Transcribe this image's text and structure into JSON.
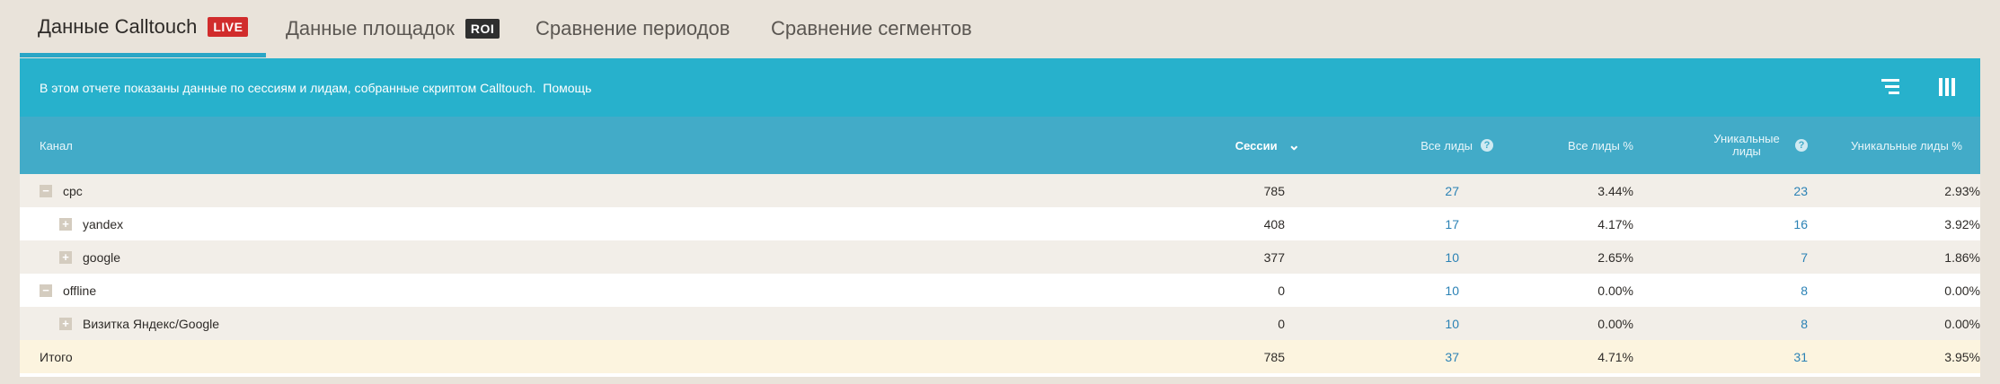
{
  "tabs": [
    {
      "label": "Данные Calltouch",
      "badge": "LIVE"
    },
    {
      "label": "Данные площадок",
      "badge": "ROI"
    },
    {
      "label": "Сравнение периодов"
    },
    {
      "label": "Сравнение сегментов"
    }
  ],
  "info": {
    "text": "В этом отчете показаны данные по сессиям и лидам, собранные скриптом Calltouch.",
    "help": "Помощь"
  },
  "icons": {
    "filter": "filter-lines-icon",
    "columns": "columns-icon"
  },
  "columns": {
    "channel": "Канал",
    "sessions": "Сессии",
    "all_leads": "Все лиды",
    "all_leads_pct": "Все лиды %",
    "unique_leads": "Уникальные лиды",
    "unique_leads_pct": "Уникальные лиды %"
  },
  "rows": [
    {
      "toggle": "−",
      "channel": "cpc",
      "sessions": "785",
      "all_leads": "27",
      "all_leads_pct": "3.44%",
      "unique_leads": "23",
      "unique_leads_pct": "2.93%"
    },
    {
      "toggle": "+",
      "channel": "yandex",
      "sessions": "408",
      "all_leads": "17",
      "all_leads_pct": "4.17%",
      "unique_leads": "16",
      "unique_leads_pct": "3.92%"
    },
    {
      "toggle": "+",
      "channel": "google",
      "sessions": "377",
      "all_leads": "10",
      "all_leads_pct": "2.65%",
      "unique_leads": "7",
      "unique_leads_pct": "1.86%"
    },
    {
      "toggle": "−",
      "channel": "offline",
      "sessions": "0",
      "all_leads": "10",
      "all_leads_pct": "0.00%",
      "unique_leads": "8",
      "unique_leads_pct": "0.00%"
    },
    {
      "toggle": "+",
      "channel": "Визитка Яндекс/Google",
      "sessions": "0",
      "all_leads": "10",
      "all_leads_pct": "0.00%",
      "unique_leads": "8",
      "unique_leads_pct": "0.00%"
    }
  ],
  "total": {
    "label": "Итого",
    "sessions": "785",
    "all_leads": "37",
    "all_leads_pct": "4.71%",
    "unique_leads": "31",
    "unique_leads_pct": "3.95%"
  },
  "colors": {
    "accent": "#27b1cc",
    "live": "#d12c2c",
    "link": "#2b82b5"
  }
}
